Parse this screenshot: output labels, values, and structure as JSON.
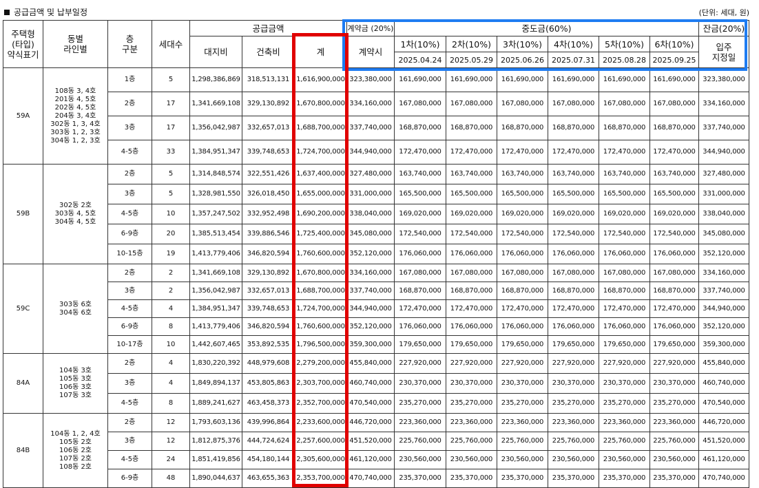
{
  "section_title": "공급금액 및 납부일정",
  "unit_note": "(단위: 세대, 원)",
  "headers": {
    "housing_type": [
      "주택형",
      "(타입)",
      "약식표기"
    ],
    "dong_line": [
      "동별",
      "라인별"
    ],
    "floor": [
      "층",
      "구분"
    ],
    "households": "세대수",
    "supply_price": "공급금액",
    "land": "대지비",
    "building": "건축비",
    "total": "계",
    "deposit_group": "계약금 (20%)",
    "deposit_sub": "계약시",
    "middle_group": "중도금(60%)",
    "balance_group": "잔금(20%)",
    "balance_sub": [
      "입주",
      "지정일"
    ],
    "middle_payments": [
      {
        "label": "1차(10%)",
        "date": "2025.04.24"
      },
      {
        "label": "2차(10%)",
        "date": "2025.05.29"
      },
      {
        "label": "3차(10%)",
        "date": "2025.06.26"
      },
      {
        "label": "4차(10%)",
        "date": "2025.07.31"
      },
      {
        "label": "5차(10%)",
        "date": "2025.08.28"
      },
      {
        "label": "6차(10%)",
        "date": "2025.09.25"
      }
    ]
  },
  "groups": [
    {
      "type": "59A",
      "dong_lines": [
        "108동 3, 4호",
        "201동 4, 5호",
        "202동 4, 5호",
        "204동 3, 4호",
        "302동 1, 3, 4호",
        "303동 1, 2, 3호",
        "304동 1, 2, 3호"
      ],
      "rows": [
        {
          "floor": "1층",
          "count": "5",
          "land": "1,298,386,869",
          "building": "318,513,131",
          "total": "1,616,900,000",
          "deposit": "323,380,000",
          "middle": "161,690,000",
          "balance": "323,380,000"
        },
        {
          "floor": "2층",
          "count": "17",
          "land": "1,341,669,108",
          "building": "329,130,892",
          "total": "1,670,800,000",
          "deposit": "334,160,000",
          "middle": "167,080,000",
          "balance": "334,160,000"
        },
        {
          "floor": "3층",
          "count": "17",
          "land": "1,356,042,987",
          "building": "332,657,013",
          "total": "1,688,700,000",
          "deposit": "337,740,000",
          "middle": "168,870,000",
          "balance": "337,740,000"
        },
        {
          "floor": "4-5층",
          "count": "33",
          "land": "1,384,951,347",
          "building": "339,748,653",
          "total": "1,724,700,000",
          "deposit": "344,940,000",
          "middle": "172,470,000",
          "balance": "344,940,000"
        }
      ]
    },
    {
      "type": "59B",
      "dong_lines": [
        "302동 2호",
        "303동 4, 5호",
        "304동 4, 5호"
      ],
      "rows": [
        {
          "floor": "2층",
          "count": "5",
          "land": "1,314,848,574",
          "building": "322,551,426",
          "total": "1,637,400,000",
          "deposit": "327,480,000",
          "middle": "163,740,000",
          "balance": "327,480,000"
        },
        {
          "floor": "3층",
          "count": "5",
          "land": "1,328,981,550",
          "building": "326,018,450",
          "total": "1,655,000,000",
          "deposit": "331,000,000",
          "middle": "165,500,000",
          "balance": "331,000,000"
        },
        {
          "floor": "4-5층",
          "count": "10",
          "land": "1,357,247,502",
          "building": "332,952,498",
          "total": "1,690,200,000",
          "deposit": "338,040,000",
          "middle": "169,020,000",
          "balance": "338,040,000"
        },
        {
          "floor": "6-9층",
          "count": "20",
          "land": "1,385,513,454",
          "building": "339,886,546",
          "total": "1,725,400,000",
          "deposit": "345,080,000",
          "middle": "172,540,000",
          "balance": "345,080,000"
        },
        {
          "floor": "10-15층",
          "count": "19",
          "land": "1,413,779,406",
          "building": "346,820,594",
          "total": "1,760,600,000",
          "deposit": "352,120,000",
          "middle": "176,060,000",
          "balance": "352,120,000"
        }
      ]
    },
    {
      "type": "59C",
      "dong_lines": [
        "303동 6호",
        "304동 6호"
      ],
      "rows": [
        {
          "floor": "2층",
          "count": "2",
          "land": "1,341,669,108",
          "building": "329,130,892",
          "total": "1,670,800,000",
          "deposit": "334,160,000",
          "middle": "167,080,000",
          "balance": "334,160,000"
        },
        {
          "floor": "3층",
          "count": "2",
          "land": "1,356,042,987",
          "building": "332,657,013",
          "total": "1,688,700,000",
          "deposit": "337,740,000",
          "middle": "168,870,000",
          "balance": "337,740,000"
        },
        {
          "floor": "4-5층",
          "count": "4",
          "land": "1,384,951,347",
          "building": "339,748,653",
          "total": "1,724,700,000",
          "deposit": "344,940,000",
          "middle": "172,470,000",
          "balance": "344,940,000"
        },
        {
          "floor": "6-9층",
          "count": "8",
          "land": "1,413,779,406",
          "building": "346,820,594",
          "total": "1,760,600,000",
          "deposit": "352,120,000",
          "middle": "176,060,000",
          "balance": "352,120,000"
        },
        {
          "floor": "10-17층",
          "count": "10",
          "land": "1,442,607,465",
          "building": "353,892,535",
          "total": "1,796,500,000",
          "deposit": "359,300,000",
          "middle": "179,650,000",
          "balance": "359,300,000"
        }
      ]
    },
    {
      "type": "84A",
      "dong_lines": [
        "104동 3호",
        "105동 3호",
        "106동 3호",
        "107동 3호"
      ],
      "rows": [
        {
          "floor": "2층",
          "count": "4",
          "land": "1,830,220,392",
          "building": "448,979,608",
          "total": "2,279,200,000",
          "deposit": "455,840,000",
          "middle": "227,920,000",
          "balance": "455,840,000"
        },
        {
          "floor": "3층",
          "count": "4",
          "land": "1,849,894,137",
          "building": "453,805,863",
          "total": "2,303,700,000",
          "deposit": "460,740,000",
          "middle": "230,370,000",
          "balance": "460,740,000"
        },
        {
          "floor": "4-5층",
          "count": "8",
          "land": "1,889,241,627",
          "building": "463,458,373",
          "total": "2,352,700,000",
          "deposit": "470,540,000",
          "middle": "235,270,000",
          "balance": "470,540,000"
        }
      ]
    },
    {
      "type": "84B",
      "dong_lines": [
        "104동 1, 2, 4호",
        "105동 2호",
        "106동 2호",
        "107동 2호",
        "108동 2호"
      ],
      "rows": [
        {
          "floor": "2층",
          "count": "12",
          "land": "1,793,603,136",
          "building": "439,996,864",
          "total": "2,233,600,000",
          "deposit": "446,720,000",
          "middle": "223,360,000",
          "balance": "446,720,000"
        },
        {
          "floor": "3층",
          "count": "12",
          "land": "1,812,875,376",
          "building": "444,724,624",
          "total": "2,257,600,000",
          "deposit": "451,520,000",
          "middle": "225,760,000",
          "balance": "451,520,000"
        },
        {
          "floor": "4-5층",
          "count": "24",
          "land": "1,851,419,856",
          "building": "454,180,144",
          "total": "2,305,600,000",
          "deposit": "461,120,000",
          "middle": "230,560,000",
          "balance": "461,120,000"
        },
        {
          "floor": "6-9층",
          "count": "48",
          "land": "1,890,044,637",
          "building": "463,655,363",
          "total": "2,353,700,000",
          "deposit": "470,740,000",
          "middle": "235,370,000",
          "balance": "470,740,000"
        }
      ]
    }
  ],
  "colors": {
    "highlight_total": "#e00000",
    "highlight_payment": "#1e7cf2"
  }
}
